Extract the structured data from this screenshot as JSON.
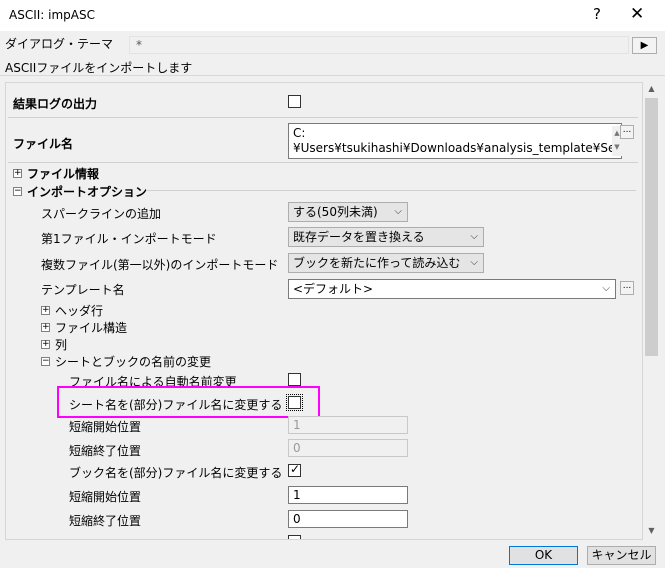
{
  "window": {
    "title": "ASCII: impASC",
    "help": "?",
    "close": "✕"
  },
  "theme": {
    "label": "ダイアログ・テーマ",
    "value": "*",
    "button": "▶"
  },
  "description": "ASCIIファイルをインポートします",
  "rows": {
    "result_log": {
      "label": "結果ログの出力",
      "checked": false
    },
    "file_name": {
      "label": "ファイル名",
      "value": "C:¥Users¥tsukihashi¥Downloads¥analysis_template¥Se",
      "button": "..."
    },
    "file_info": {
      "label": "ファイル情報",
      "expander": "+"
    },
    "import_options": {
      "label": "インポートオプション",
      "expander": "−"
    },
    "sparkline": {
      "label": "スパークラインの追加",
      "value": "する(50列未満)"
    },
    "first_mode": {
      "label": "第1ファイル・インポートモード",
      "value": "既存データを置き換える"
    },
    "multi_mode": {
      "label": "複数ファイル(第一以外)のインポートモード",
      "value": "ブックを新たに作って読み込む"
    },
    "template": {
      "label": "テンプレート名",
      "value": "<デフォルト>",
      "button": "..."
    },
    "header_rows": {
      "label": "ヘッダ行",
      "expander": "+"
    },
    "file_structure": {
      "label": "ファイル構造",
      "expander": "+"
    },
    "columns": {
      "label": "列",
      "expander": "+"
    },
    "rename": {
      "label": "シートとブックの名前の変更",
      "expander": "−"
    },
    "auto_rename": {
      "label": "ファイル名による自動名前変更",
      "checked": false
    },
    "sheet_rename": {
      "label": "シート名を(部分)ファイル名に変更する",
      "checked": false
    },
    "sheet_start": {
      "label": "短縮開始位置",
      "value": "1"
    },
    "sheet_end": {
      "label": "短縮終了位置",
      "value": "0"
    },
    "book_rename": {
      "label": "ブック名を(部分)ファイル名に変更する",
      "checked": true
    },
    "book_start": {
      "label": "短縮開始位置",
      "value": "1"
    },
    "book_end": {
      "label": "短縮終了位置",
      "value": "0"
    }
  },
  "buttons": {
    "ok": "OK",
    "cancel": "キャンセル"
  },
  "colors": {
    "highlight": "#ff00ff",
    "default_button": "#0078d7"
  }
}
